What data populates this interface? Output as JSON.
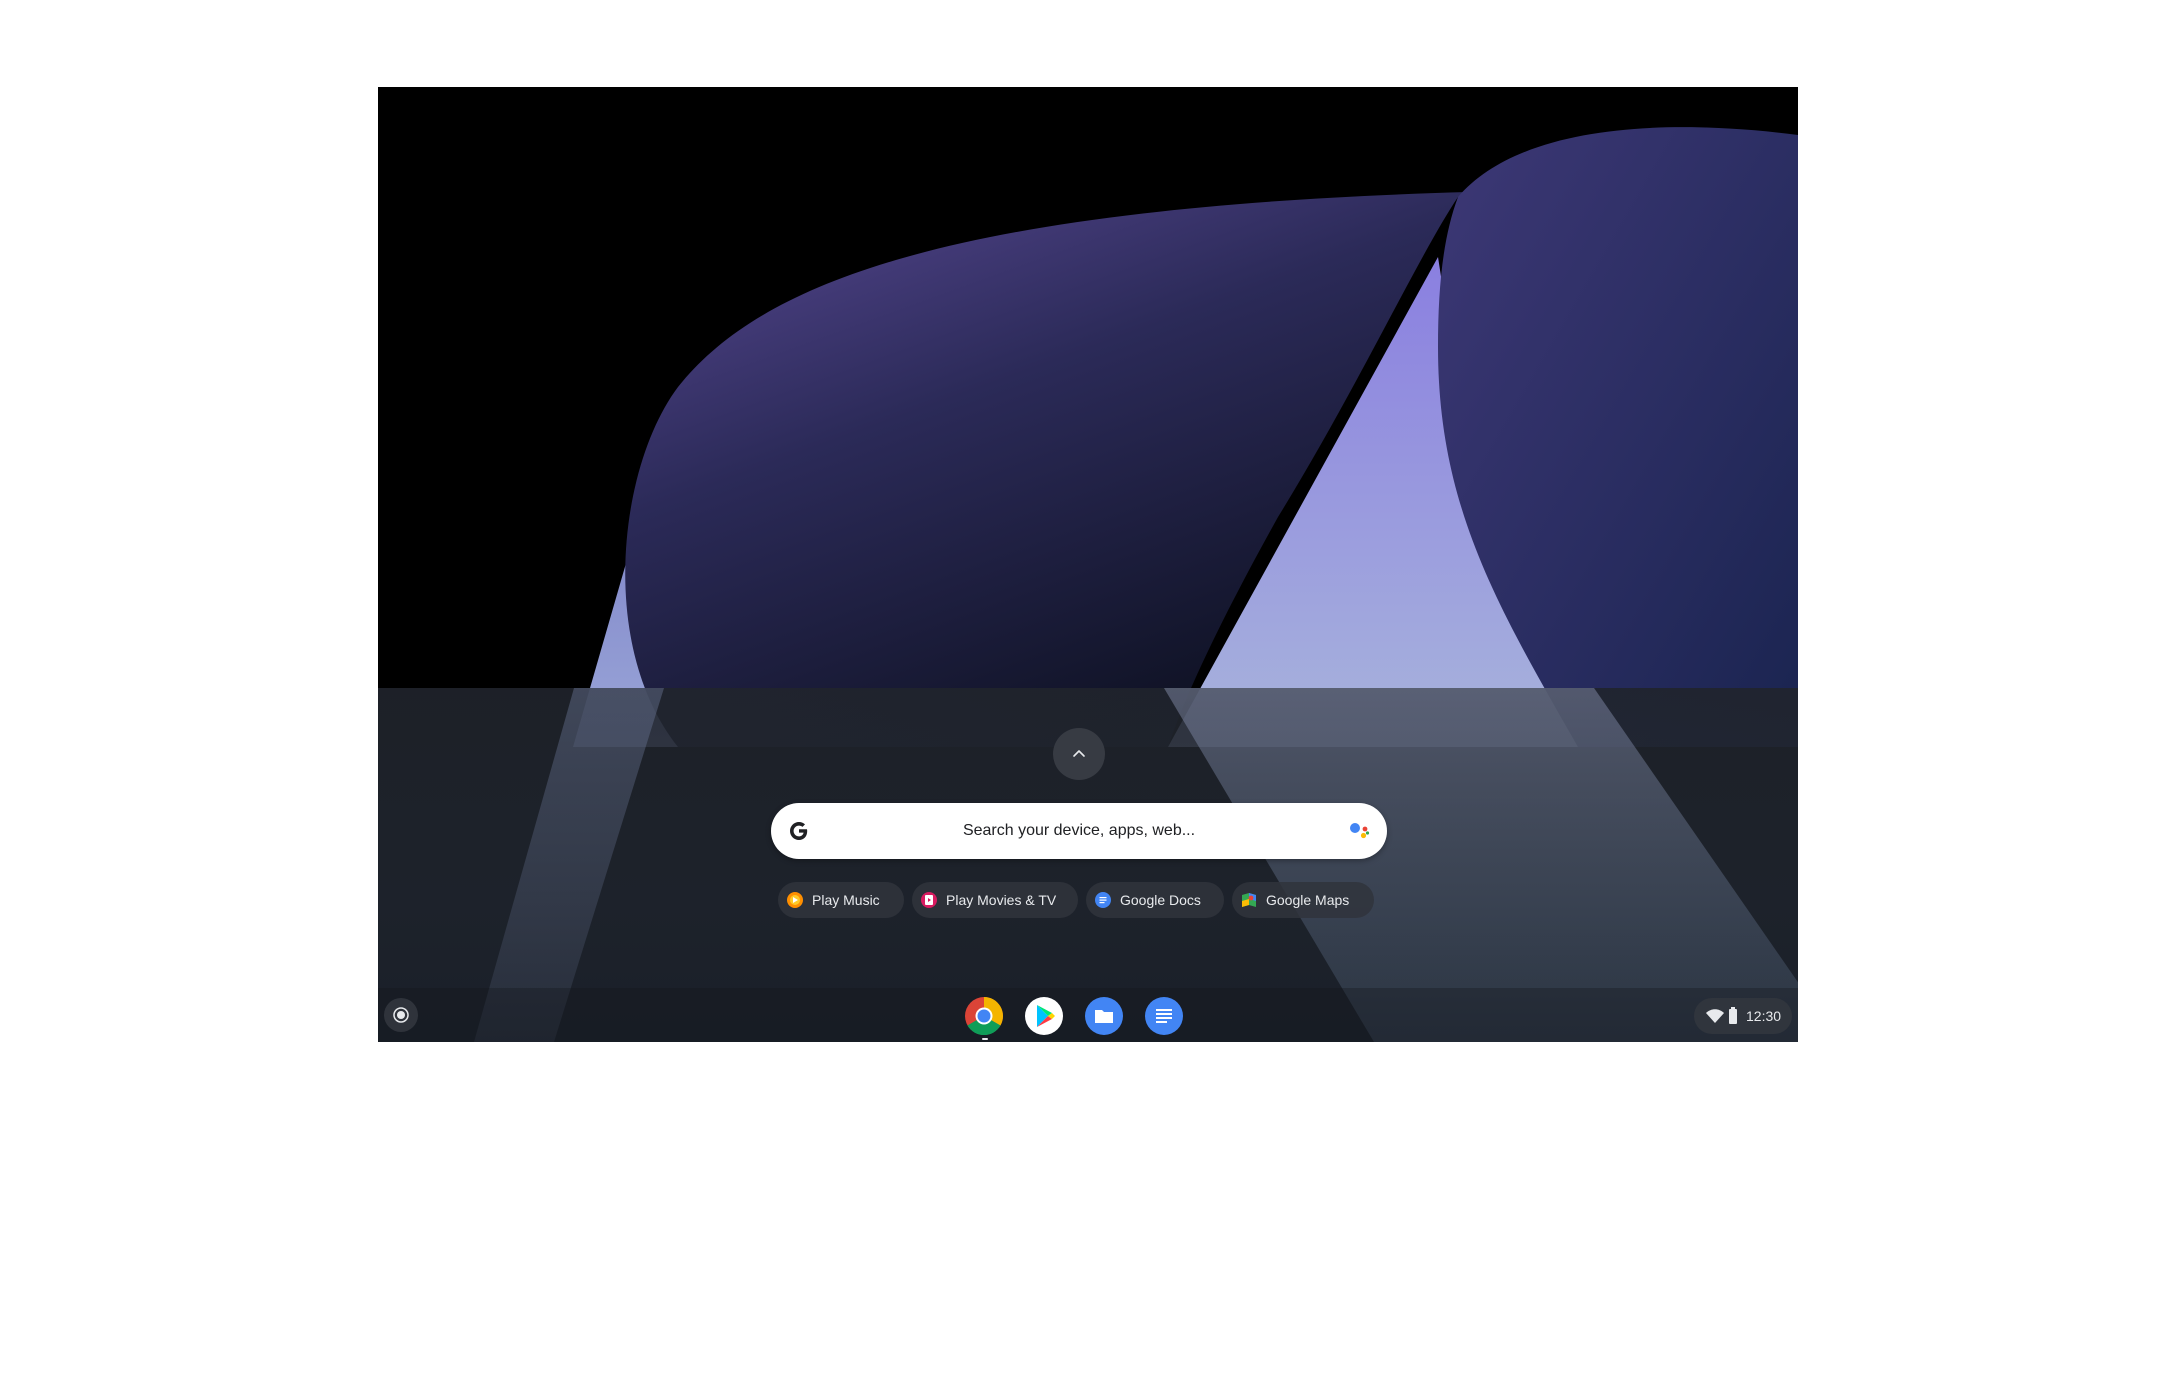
{
  "launcher": {
    "expand_icon": "chevron-up-icon",
    "search": {
      "placeholder": "Search your device, apps, web...",
      "left_icon": "google-g-icon",
      "right_icon": "google-assistant-icon"
    },
    "suggestions": [
      {
        "label": "Play Music",
        "icon": "play-music-icon"
      },
      {
        "label": "Play Movies & TV",
        "icon": "play-movies-icon"
      },
      {
        "label": "Google Docs",
        "icon": "google-docs-icon"
      },
      {
        "label": "Google Maps",
        "icon": "google-maps-icon"
      }
    ]
  },
  "shelf": {
    "launcher_icon": "launcher-circle-icon",
    "apps": [
      "chrome-icon",
      "play-store-icon",
      "files-icon",
      "docs-icon"
    ],
    "status": {
      "wifi_icon": "wifi-icon",
      "battery_icon": "battery-icon",
      "time": "12:30"
    }
  },
  "colors": {
    "wallpaper_purple": "#5a4a9a",
    "wallpaper_light": "#a6a8e0",
    "wallpaper_dark": "#1f2a58",
    "chip_bg": "#30343c",
    "text_light": "#e8eaed"
  }
}
